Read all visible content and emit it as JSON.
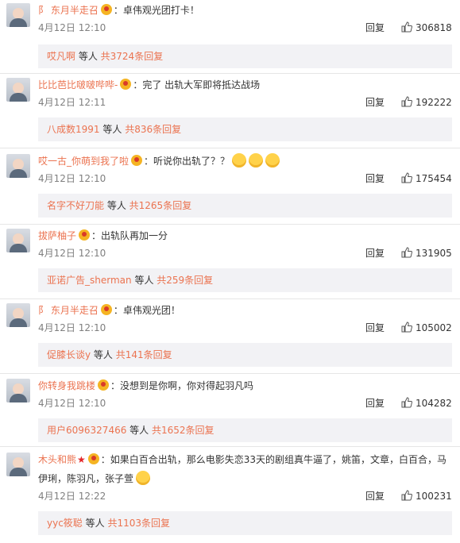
{
  "labels": {
    "reply": "回复",
    "etc": " 等人 "
  },
  "comments": [
    {
      "user": "阝 东月半走召",
      "content": "：卓伟观光团打卡！",
      "emoji": [],
      "time": "4月12日 12:10",
      "likes": "306818",
      "reply_name": "哎凡啊",
      "reply_total": "共3724条回复"
    },
    {
      "user": "比比芭比啵啵哔哔-",
      "content": "：完了 出轨大军即将抵达战场",
      "emoji": [],
      "time": "4月12日 12:11",
      "likes": "192222",
      "reply_name": "八成数1991",
      "reply_total": "共836条回复"
    },
    {
      "user": "哎一古_你萌到我了啦",
      "content": "：听说你出轨了？？",
      "emoji": [
        "emoji",
        "emoji",
        "emoji"
      ],
      "time": "4月12日 12:10",
      "likes": "175454",
      "reply_name": "名字不好刀能",
      "reply_total": "共1265条回复"
    },
    {
      "user": "拔萨柚子",
      "content": "：出轨队再加一分",
      "emoji": [],
      "time": "4月12日 12:10",
      "likes": "131905",
      "reply_name": "亚诺广告_sherman",
      "reply_total": "共259条回复"
    },
    {
      "user": "阝 东月半走召",
      "content": "：卓伟观光团！",
      "emoji": [],
      "time": "4月12日 12:10",
      "likes": "105002",
      "reply_name": "促膝长谈y",
      "reply_total": "共141条回复"
    },
    {
      "user": "你转身我跳楼",
      "content": "：没想到是你啊，你对得起羽凡吗",
      "emoji": [],
      "time": "4月12日 12:10",
      "likes": "104282",
      "reply_name": "用户6096327466",
      "reply_total": "共1652条回复"
    },
    {
      "user": "木头和熊",
      "content": "：如果白百合出轨，那么电影失恋33天的剧组真牛逼了，姚笛，文章，白百合，马",
      "content2": "伊琍，陈羽凡，张子萱",
      "emoji": [
        "emoji"
      ],
      "time": "4月12日 12:22",
      "likes": "100231",
      "reply_name": "yyc筱聪",
      "reply_total": "共1103条回复"
    }
  ]
}
